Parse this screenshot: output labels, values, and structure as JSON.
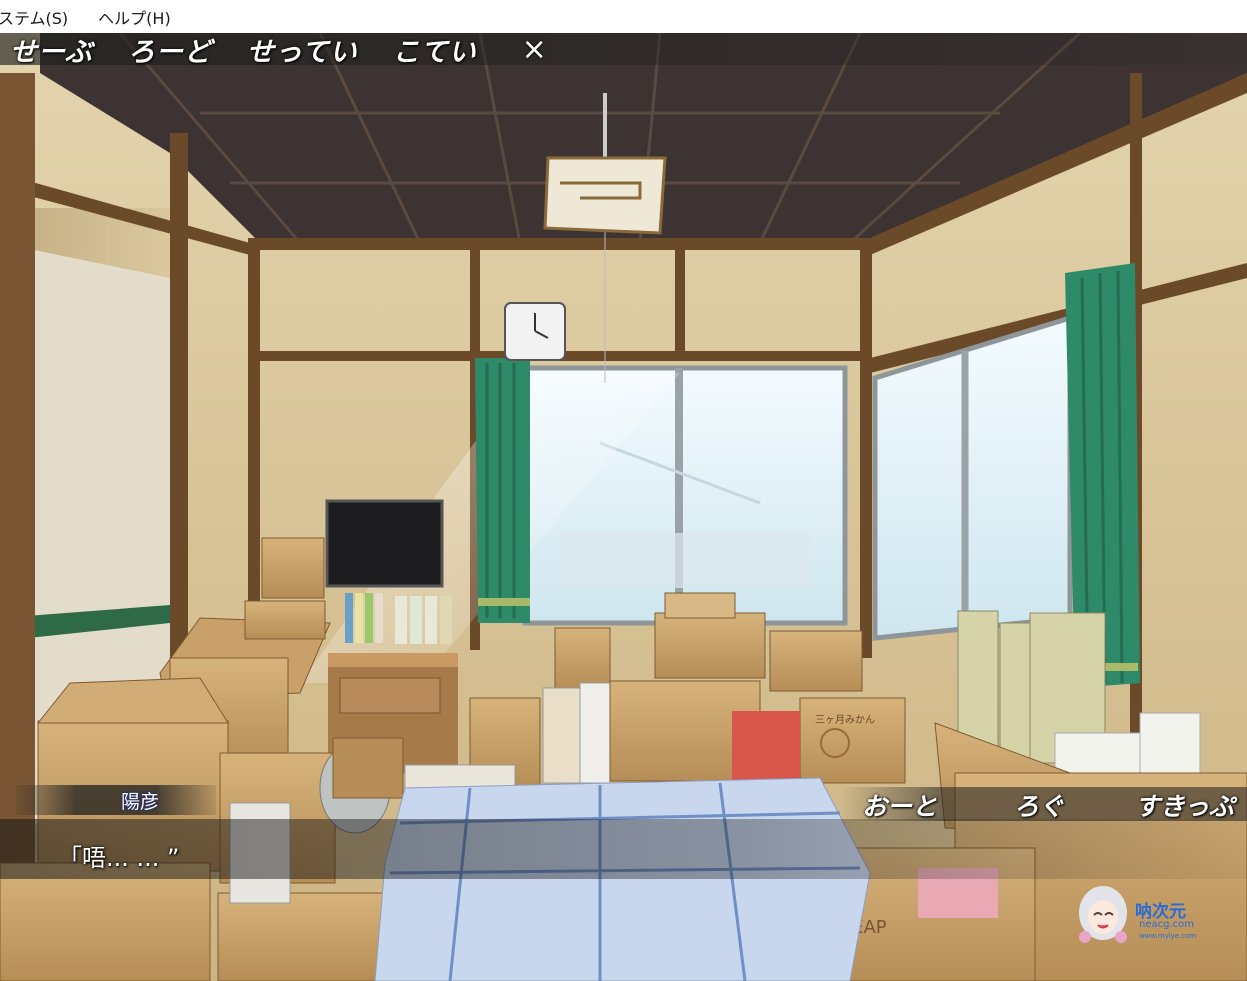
{
  "window_menu": {
    "items": [
      "システム(S)",
      "ヘルプ(H)"
    ],
    "display_items": [
      "ステム(S)",
      "ヘルプ(H)"
    ]
  },
  "game_menu": {
    "save": "せーぶ",
    "load": "ろーど",
    "settings": "せってい",
    "fix": "こてい",
    "close": "×"
  },
  "dialogue": {
    "speaker": "陽彦",
    "text": "「唔... ... ”"
  },
  "controls": {
    "auto": "おーと",
    "log": "ろぐ",
    "skip": "すきっぷ"
  },
  "watermark": {
    "title": "呐次元",
    "url1": "neacg.com",
    "url2": "www.mylye.com"
  },
  "scene_text": {
    "box_brand": "CHEAP",
    "box_mikan": "三ヶ月みかん"
  },
  "colors": {
    "curtain": "#2f8a6a",
    "window_light": "#e6f4fb",
    "wall": "#d8c59c",
    "wood_frame": "#6b4a2a",
    "ceiling": "#3a3030",
    "cardboard": "#c9a26a",
    "futon_blue": "#b9c9e6"
  }
}
